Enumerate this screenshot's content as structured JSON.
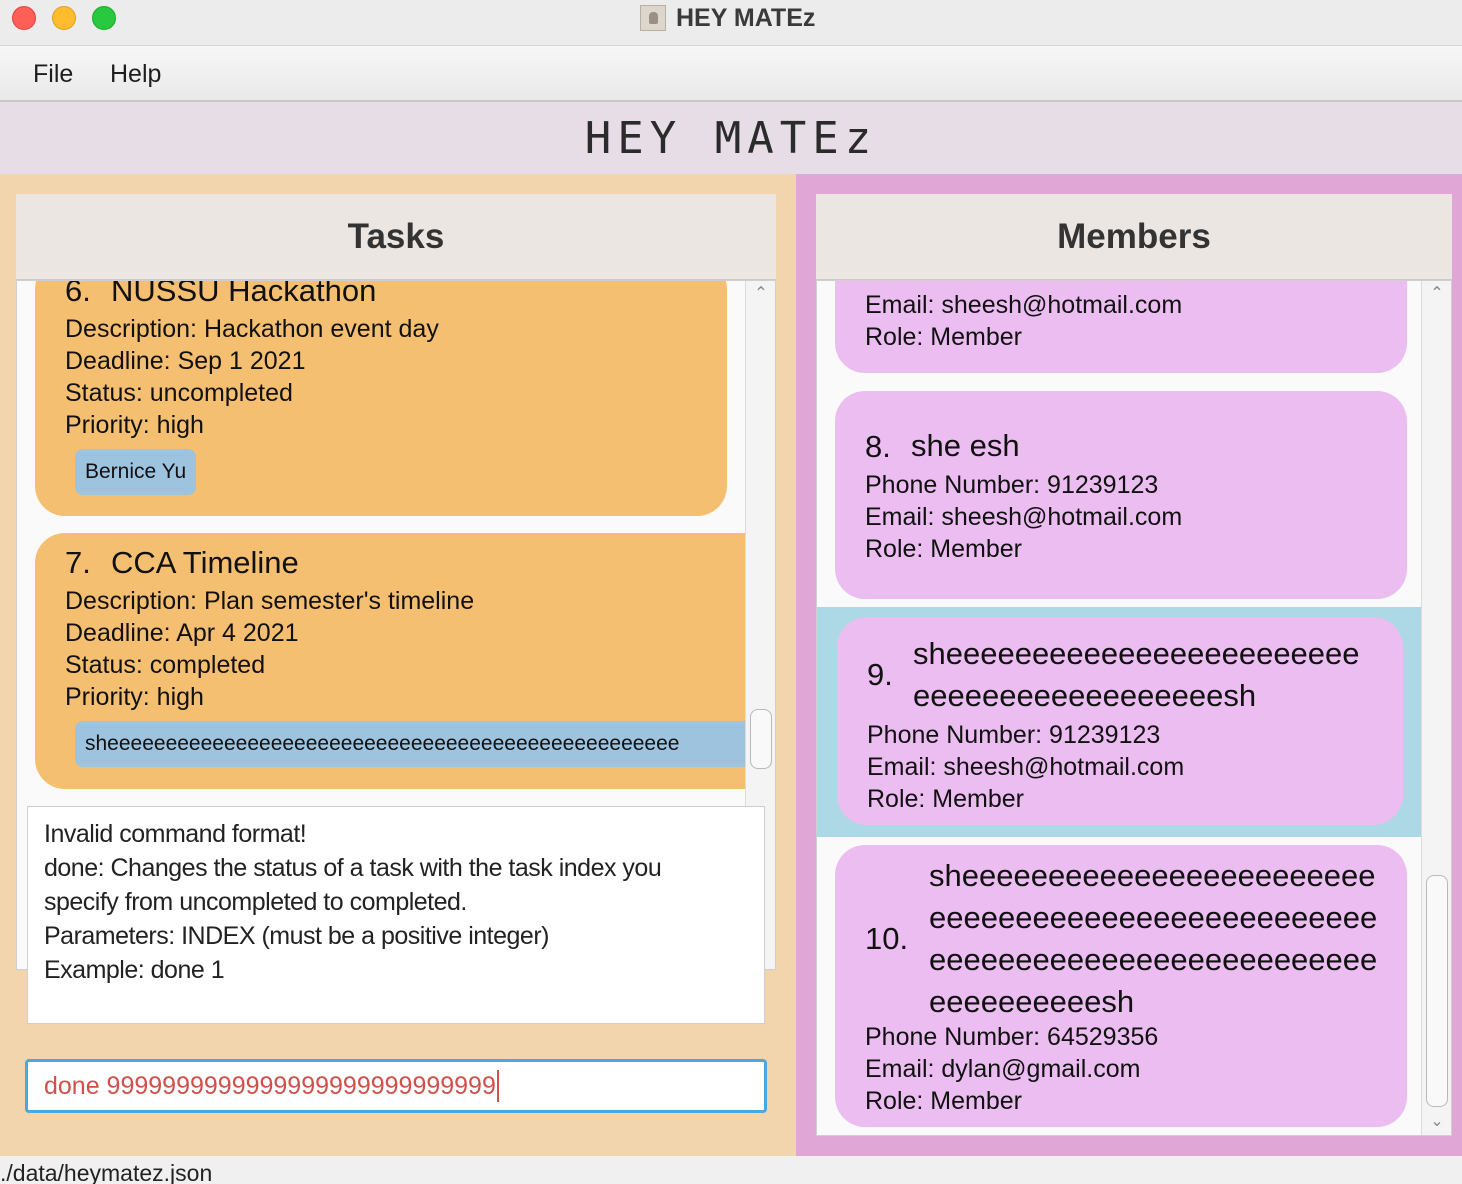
{
  "window": {
    "title": "HEY MATEz"
  },
  "menu": {
    "file": "File",
    "help": "Help"
  },
  "app_header": "HEY MATEz",
  "tasks": {
    "header": "Tasks",
    "items": [
      {
        "index": "6.",
        "name": "NUSSU Hackathon",
        "description": "Description: Hackathon event day",
        "deadline": "Deadline: Sep 1 2021",
        "status": "Status: uncompleted",
        "priority": "Priority: high",
        "tag": "Bernice Yu"
      },
      {
        "index": "7.",
        "name": "CCA Timeline",
        "description": "Description: Plan semester's timeline",
        "deadline": "Deadline: Apr 4 2021",
        "status": "Status: completed",
        "priority": "Priority: high",
        "tag": "sheeeeeeeeeeeeeeeeeeeeeeeeeeeeeeeeeeeeeeeeeeeeeeeee"
      }
    ]
  },
  "result": {
    "lines": [
      "Invalid command format!",
      "done: Changes the status of a task with the task index you",
      "specify from uncompleted to completed.",
      "Parameters: INDEX (must be a positive integer)",
      "Example: done 1"
    ]
  },
  "command": {
    "value": "done 9999999999999999999999999999"
  },
  "members": {
    "header": "Members",
    "items": [
      {
        "email": "Email: sheesh@hotmail.com",
        "role": "Role: Member"
      },
      {
        "index": "8.",
        "name": "she esh",
        "phone": "Phone Number: 91239123",
        "email": "Email: sheesh@hotmail.com",
        "role": "Role: Member"
      },
      {
        "index": "9.",
        "name_lines": [
          "sheeeeeeeeeeeeeeeeeeeeeeee",
          "eeeeeeeeeeeeeeeeeesh"
        ],
        "phone": "Phone Number: 91239123",
        "email": "Email: sheesh@hotmail.com",
        "role": "Role: Member",
        "selected": true
      },
      {
        "index": "10.",
        "name_lines": [
          "sheeeeeeeeeeeeeeeeeeeeeeee",
          "eeeeeeeeeeeeeeeeeeeeeeeeee",
          "eeeeeeeeeeeeeeeeeeeeeeeeee",
          "eeeeeeeeeesh"
        ],
        "phone": "Phone Number: 64529356",
        "email": "Email: dylan@gmail.com",
        "role": "Role: Member"
      }
    ]
  },
  "status_bar": "./data/heymatez.json",
  "colors": {
    "tasks_pane": "#f2d5ad",
    "task_card": "#f5bf71",
    "tag": "#9dc3df",
    "members_pane": "#dfa6d6",
    "member_card": "#ecbdf1",
    "selected_row": "#add8e6",
    "command_text": "#d0504a"
  }
}
